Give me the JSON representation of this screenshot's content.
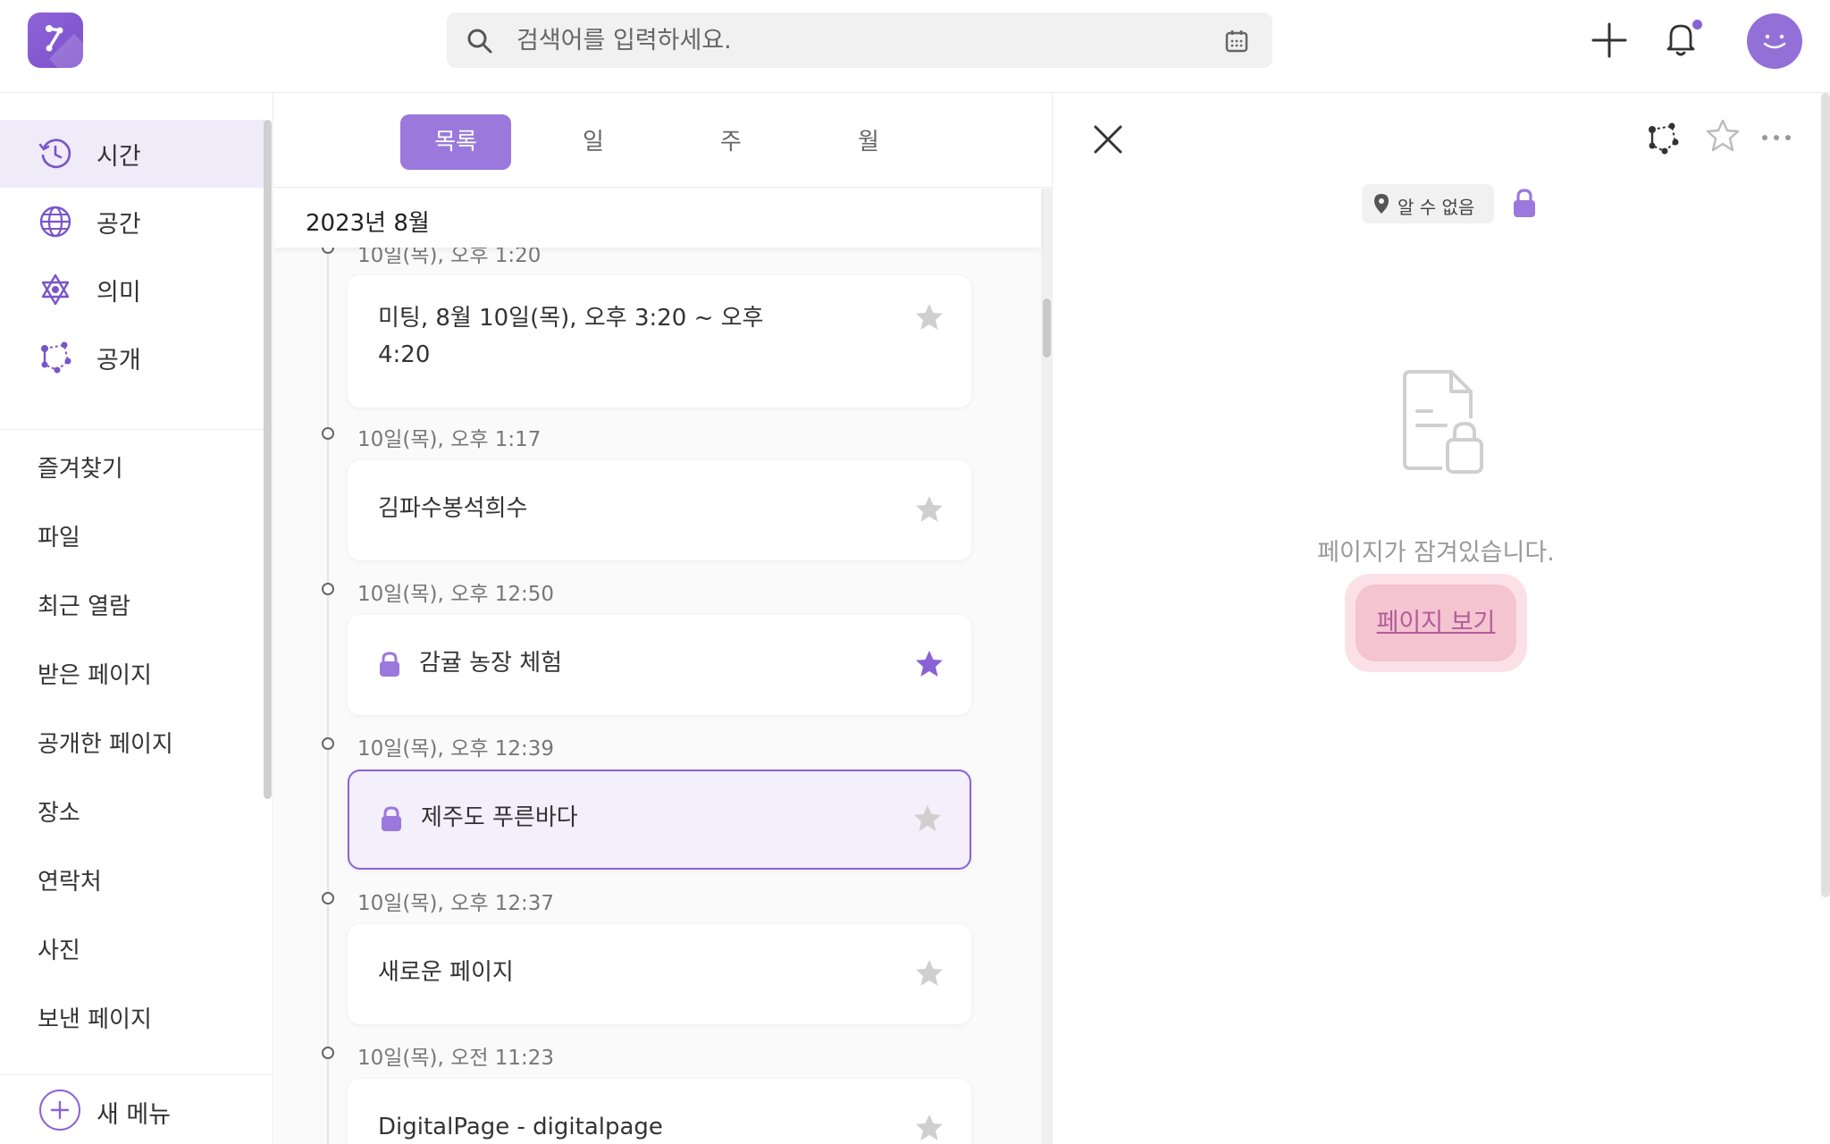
{
  "search": {
    "placeholder": "검색어를 입력하세요."
  },
  "sidebar": {
    "nav": [
      {
        "label": "시간",
        "icon": "clock-history-icon"
      },
      {
        "label": "공간",
        "icon": "globe-icon"
      },
      {
        "label": "의미",
        "icon": "hexagram-icon"
      },
      {
        "label": "공개",
        "icon": "share-network-icon"
      }
    ],
    "menu": [
      "즐겨찾기",
      "파일",
      "최근 열람",
      "받은 페이지",
      "공개한 페이지",
      "장소",
      "연락처",
      "사진",
      "보낸 페이지"
    ],
    "new_menu": "새 메뉴"
  },
  "tabs": [
    "목록",
    "일",
    "주",
    "월"
  ],
  "month": "2023년 8월",
  "timeline": [
    {
      "time": "10일(목), 오후 1:20",
      "title": "미팅, 8월 10일(목), 오후 3:20 ~ 오후 4:20",
      "locked": false,
      "starred": false
    },
    {
      "time": "10일(목), 오후 1:17",
      "title": "김파수봉석희수",
      "locked": false,
      "starred": false
    },
    {
      "time": "10일(목), 오후 12:50",
      "title": "감귤 농장 체험",
      "locked": true,
      "starred": true
    },
    {
      "time": "10일(목), 오후 12:39",
      "title": "제주도 푸른바다",
      "locked": true,
      "starred": false,
      "selected": true
    },
    {
      "time": "10일(목), 오후 12:37",
      "title": "새로운 페이지",
      "locked": false,
      "starred": false
    },
    {
      "time": "10일(목), 오전 11:23",
      "title": "DigitalPage - digitalpage",
      "locked": false,
      "starred": false
    }
  ],
  "detail": {
    "location": "알 수 없음",
    "locked_message": "페이지가 잠겨있습니다.",
    "view_button": "페이지 보기"
  },
  "colors": {
    "accent": "#8a62d6",
    "tab_active": "#9a78dc",
    "pink_button": "#f4c4d0",
    "pink_text": "#b25c9a"
  }
}
